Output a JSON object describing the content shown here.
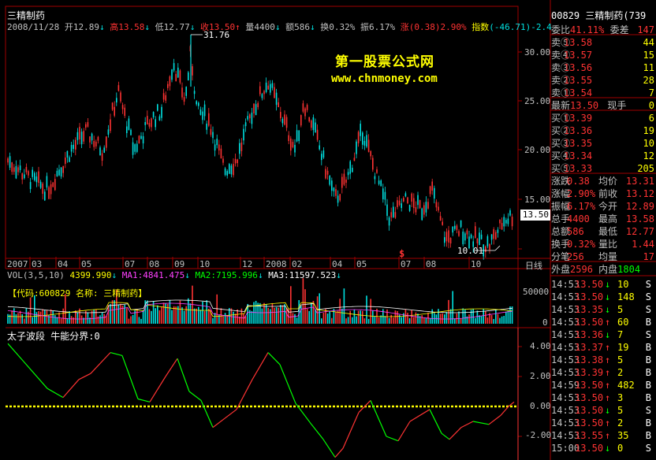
{
  "colors": {
    "up": "#ff3333",
    "down": "#00e0e0",
    "yellow": "#ffff00",
    "white": "#ffffff",
    "green": "#00ff00",
    "magenta": "#ff40ff",
    "frame": "#a00000",
    "grid": "#800000",
    "axis_text": "#c0c0c0",
    "watermark": "#ffff00"
  },
  "chart": {
    "stock_name": "三精制药",
    "header": {
      "date": "2008/11/28",
      "open_label": "开",
      "open": "12.89",
      "high_label": "高",
      "high": "13.58",
      "low_label": "低",
      "low": "12.77",
      "close_label": "收",
      "close": "13.50",
      "vol_label": "量",
      "vol": "4400",
      "amt_label": "额",
      "amt": "586",
      "turnover_label": "换",
      "turnover": "0.32%",
      "amp_label": "振",
      "amp": "6.17%",
      "chg_label": "涨",
      "chg": "(0.38)",
      "chg_pct": "2.90%",
      "index_label": "指数",
      "index": "(-46.71)-2.4"
    },
    "watermark_line1": "第一股票公式网",
    "watermark_line2": "www.chnmoney.com",
    "peak_label": "31.76",
    "trough_label": "10.01",
    "current_price_tag": "13.50",
    "marker_s": "$",
    "period_label": "日线",
    "x_labels": [
      "2007",
      "03",
      "04",
      "05",
      "07",
      "08",
      "09",
      "10",
      "12",
      "2008",
      "02",
      "04",
      "05",
      "07",
      "08",
      "10"
    ],
    "y_labels": [
      "30.00",
      "25.00",
      "20.00",
      "15.00"
    ],
    "volume": {
      "title": "VOL(3,5,10)",
      "value": "4399.990",
      "ma1_label": "MA1:",
      "ma1": "4841.475",
      "ma2_label": "MA2:",
      "ma2": "7195.996",
      "ma3_label": "MA3:",
      "ma3": "11597.523",
      "overlay_text": "【代码:600829  名称: 三精制药】",
      "y_labels": [
        "50000",
        "0"
      ]
    },
    "indicator": {
      "title": "太子波段",
      "subtitle": "牛能分界:0",
      "y_labels": [
        "4.00",
        "2.00",
        "0.00",
        "-2.00"
      ]
    }
  },
  "quote": {
    "code": "00829",
    "name": "三精制药",
    "name_suffix": "(739",
    "ratio_label": "委比",
    "ratio": "41.11%",
    "diff_label": "委差",
    "diff": "147",
    "sell": [
      {
        "label": "卖⑤",
        "price": "13.58",
        "vol": "44"
      },
      {
        "label": "卖④",
        "price": "13.57",
        "vol": "15"
      },
      {
        "label": "卖③",
        "price": "13.56",
        "vol": "11"
      },
      {
        "label": "卖②",
        "price": "13.55",
        "vol": "28"
      },
      {
        "label": "卖①",
        "price": "13.54",
        "vol": "7"
      }
    ],
    "last_label": "最新",
    "last": "13.50",
    "hand_label": "现手",
    "hand": "0",
    "buy": [
      {
        "label": "买①",
        "price": "13.39",
        "vol": "6"
      },
      {
        "label": "买②",
        "price": "13.36",
        "vol": "19"
      },
      {
        "label": "买③",
        "price": "13.35",
        "vol": "10"
      },
      {
        "label": "买④",
        "price": "13.34",
        "vol": "12"
      },
      {
        "label": "买⑤",
        "price": "13.33",
        "vol": "205"
      }
    ],
    "stats": [
      {
        "l1": "涨跌",
        "v1": "0.38",
        "l2": "均价",
        "v2": "13.31"
      },
      {
        "l1": "涨幅",
        "v1": "2.90%",
        "l2": "前收",
        "v2": "13.12"
      },
      {
        "l1": "振幅",
        "v1": "6.17%",
        "l2": "今开",
        "v2": "12.89"
      },
      {
        "l1": "总手",
        "v1": "4400",
        "l2": "最高",
        "v2": "13.58"
      },
      {
        "l1": "总额",
        "v1": "586",
        "l2": "最低",
        "v2": "12.77"
      },
      {
        "l1": "换手",
        "v1": "0.32%",
        "l2": "量比",
        "v2": "1.44"
      },
      {
        "l1": "分笔",
        "v1": "256",
        "l2": "均量",
        "v2": "17"
      }
    ],
    "outer_label": "外盘",
    "outer": "2596",
    "inner_label": "内盘",
    "inner": "1804",
    "ticks": [
      {
        "t": "14:53",
        "p": "13.50",
        "v": "10",
        "s": "S"
      },
      {
        "t": "14:53",
        "p": "13.50",
        "v": "148",
        "s": "S"
      },
      {
        "t": "14:53",
        "p": "13.35",
        "v": "5",
        "s": "S"
      },
      {
        "t": "14:53",
        "p": "13.50",
        "v": "60",
        "s": "B"
      },
      {
        "t": "14:53",
        "p": "13.36",
        "v": "7",
        "s": "S"
      },
      {
        "t": "14:53",
        "p": "13.37",
        "v": "19",
        "s": "B"
      },
      {
        "t": "14:53",
        "p": "13.38",
        "v": "5",
        "s": "B"
      },
      {
        "t": "14:53",
        "p": "13.39",
        "v": "2",
        "s": "B"
      },
      {
        "t": "14:59",
        "p": "13.50",
        "v": "482",
        "s": "B"
      },
      {
        "t": "14:53",
        "p": "13.50",
        "v": "3",
        "s": "B"
      },
      {
        "t": "14:53",
        "p": "13.50",
        "v": "5",
        "s": "S"
      },
      {
        "t": "14:53",
        "p": "13.50",
        "v": "2",
        "s": "B"
      },
      {
        "t": "14:53",
        "p": "13.55",
        "v": "35",
        "s": "B"
      },
      {
        "t": "15:00",
        "p": "13.50",
        "v": "0",
        "s": "S"
      }
    ]
  }
}
